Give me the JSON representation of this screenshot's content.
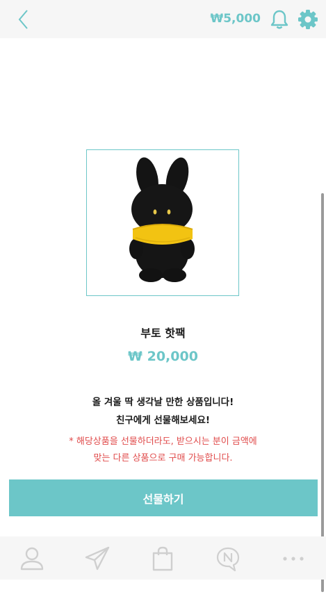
{
  "header": {
    "balance": "₩5,000",
    "icons": [
      "chevron-left-icon",
      "bell-icon",
      "gear-icon"
    ]
  },
  "product": {
    "name": "부토 핫팩",
    "price": "₩ 20,000",
    "image": "black-bunny-plush-with-yellow-scarf"
  },
  "description": {
    "line1": "올 겨울 딱 생각날 만한 상품입니다!",
    "line2": "친구에게 선물해보세요!"
  },
  "notice": {
    "line1": "* 해당상품을 선물하더라도, 받으시는 분이 금액에",
    "line2": "맞는 다른 상품으로 구매 가능합니다."
  },
  "actions": {
    "gift_label": "선물하기"
  },
  "bottom_nav": {
    "items": [
      "profile-icon",
      "send-icon",
      "shopping-bag-icon",
      "naver-chat-icon",
      "more-icon"
    ]
  },
  "colors": {
    "accent": "#6cc6c8",
    "warning": "#e04b4b",
    "bar_background": "#f6f6f6"
  }
}
